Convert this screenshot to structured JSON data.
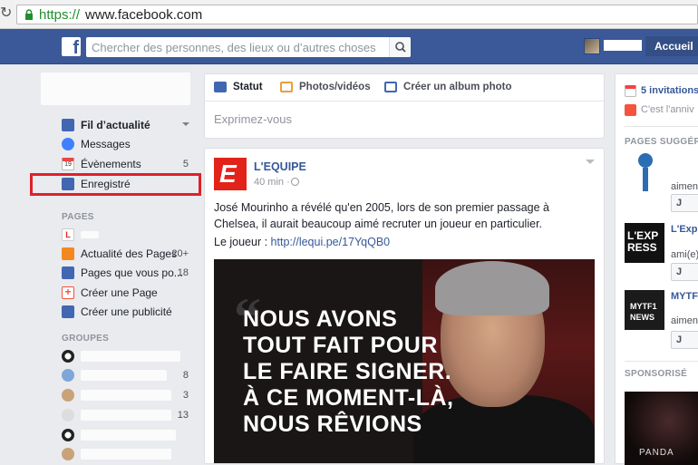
{
  "browser": {
    "url_protocol": "https://",
    "url_host": "www.facebook.com"
  },
  "topbar": {
    "search_placeholder": "Chercher des personnes, des lieux ou d’autres choses",
    "home_label": "Accueil"
  },
  "left_nav": {
    "items": [
      {
        "label": "Fil d’actualité",
        "count": "",
        "icon": "newsfeed-icon",
        "color": "#4267b2"
      },
      {
        "label": "Messages",
        "count": "",
        "icon": "messages-icon",
        "color": "#4080ff"
      },
      {
        "label": "Évènements",
        "count": "5",
        "icon": "events-icon",
        "color": "#e44"
      },
      {
        "label": "Enregistré",
        "count": "",
        "icon": "saved-icon",
        "color": "#4267b2"
      }
    ],
    "pages_title": "PAGES",
    "pages_items": [
      {
        "label": "Actualité des Pages",
        "count": "20+",
        "icon": "megaphone-icon",
        "color": "#f5871f"
      },
      {
        "label": "Pages que vous po...",
        "count": "18",
        "icon": "like-pages-icon",
        "color": "#4267b2"
      },
      {
        "label": "Créer une Page",
        "count": "",
        "icon": "create-page-icon",
        "color": "#f5533d"
      },
      {
        "label": "Créer une publicité",
        "count": "",
        "icon": "create-ad-icon",
        "color": "#4267b2"
      }
    ],
    "groups_title": "GROUPES",
    "groups_counts": [
      "",
      "8",
      "3",
      "13",
      "",
      ""
    ]
  },
  "composer": {
    "tabs": [
      {
        "label": "Statut",
        "icon": "status-icon",
        "color": "#4267b2"
      },
      {
        "label": "Photos/vidéos",
        "icon": "photo-icon",
        "color": "#e8a03c"
      },
      {
        "label": "Créer un album photo",
        "icon": "album-icon",
        "color": "#4267b2"
      }
    ],
    "placeholder": "Exprimez-vous"
  },
  "post": {
    "author": "L'EQUIPE",
    "logo_letter": "E",
    "time": "40 min",
    "time_sep": "·",
    "text": "José Mourinho a révélé qu'en 2005, lors de son premier passage à Chelsea, il aurait beaucoup aimé recruter un joueur en particulier.",
    "link_label": "Le joueur : ",
    "link_url": "http://lequi.pe/17YqQB0",
    "image_quote_mark": "“",
    "image_headline": "NOUS AVONS TOUT FAIT POUR LE FAIRE SIGNER. À CE MOMENT-LÀ, NOUS RÊVIONS"
  },
  "right_col": {
    "invitations": "5 invitations",
    "birthday": "C'est l'anniv",
    "suggested_title": "PAGES SUGGÉRÉ",
    "suggested": [
      {
        "name": "",
        "sub": "aimen",
        "thumb_color": "#ffffff",
        "thumb_label": ""
      },
      {
        "name": "L'Exp",
        "sub": "ami(e)",
        "thumb_color": "#111111",
        "thumb_label": "L'EXP RESS"
      },
      {
        "name": "MYTF",
        "sub": "aimen",
        "thumb_color": "#1b1b1b",
        "thumb_label": "MYTF1 NEWS"
      }
    ],
    "like_label": "J",
    "sponsored_title": "SPONSORISÉ",
    "sponsored_image_text": "PANDA"
  }
}
